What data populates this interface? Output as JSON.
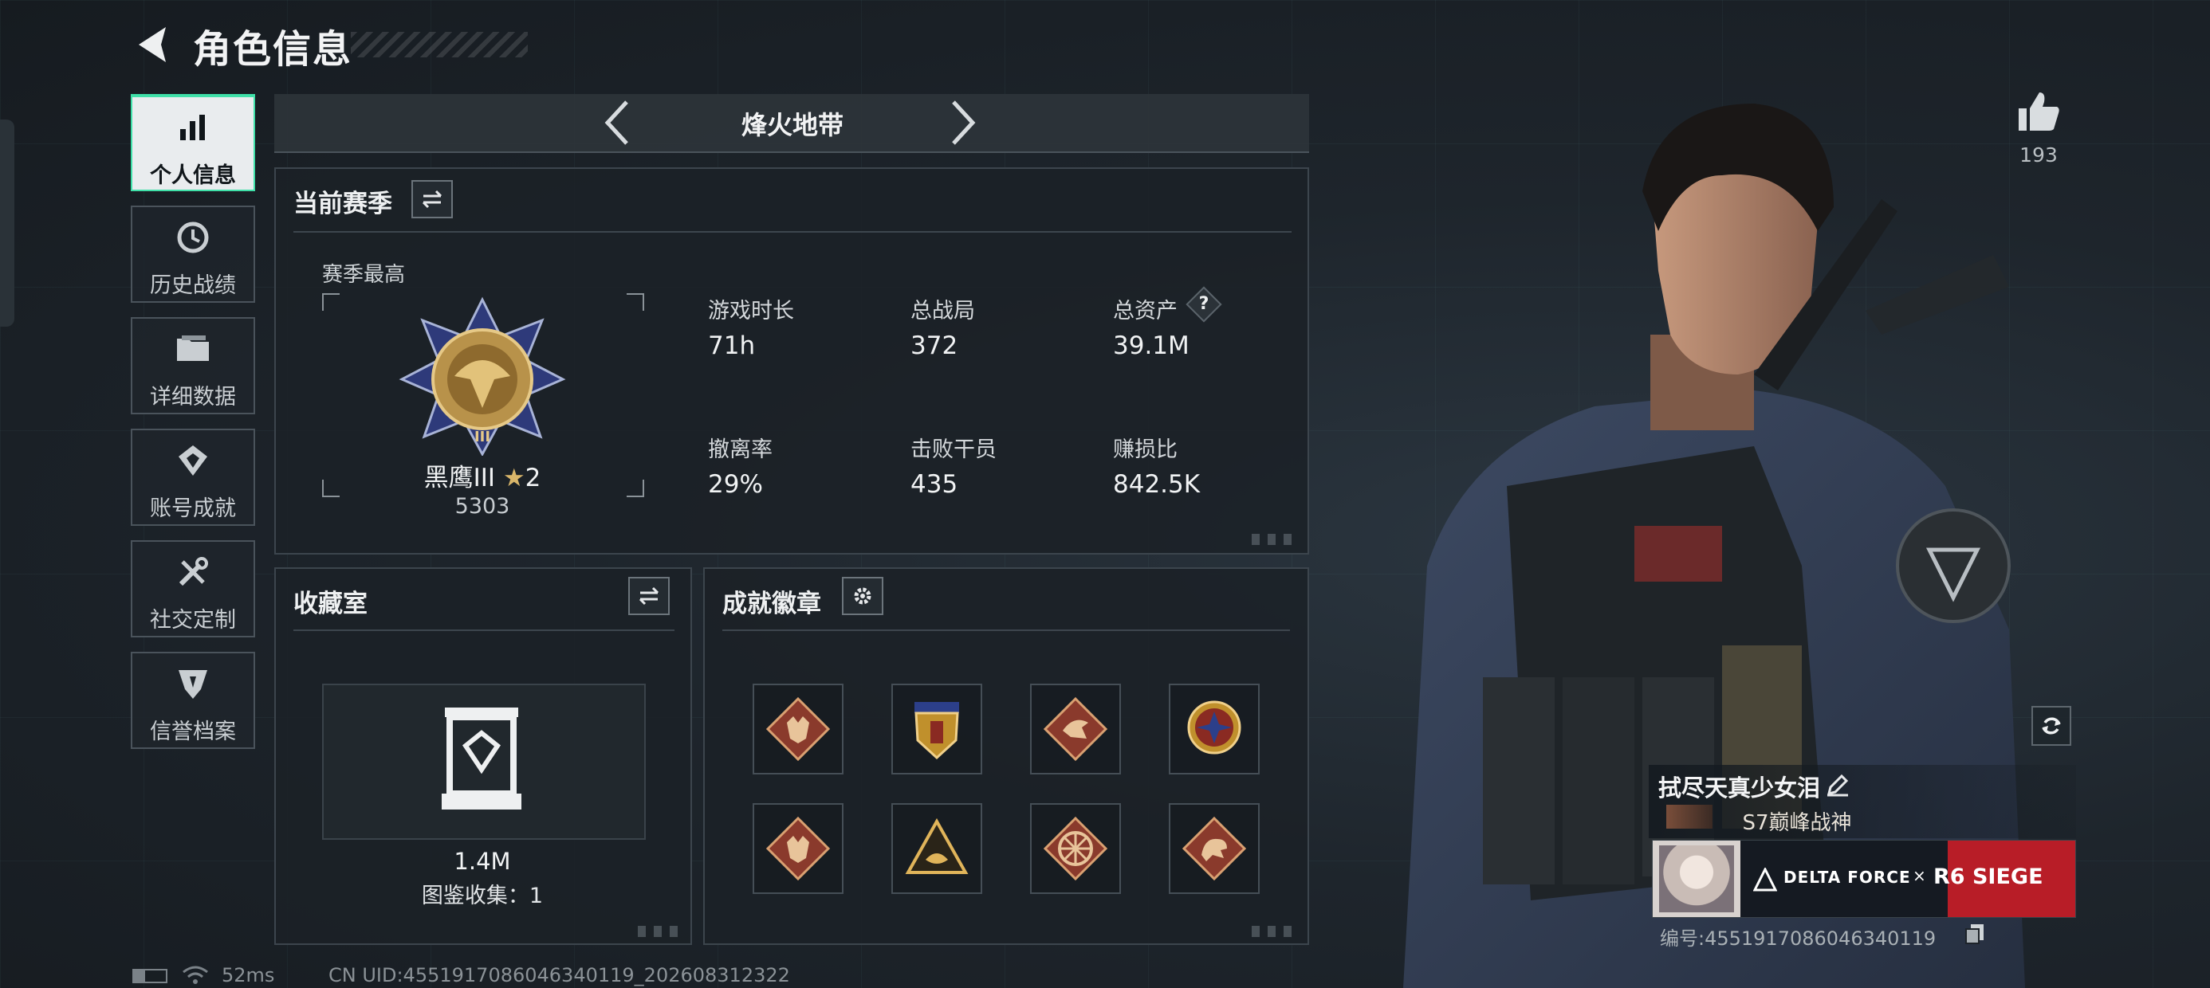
{
  "header": {
    "title": "角色信息"
  },
  "sidebar": {
    "items": [
      {
        "label": "个人信息",
        "icon": "bar-chart-icon",
        "active": true
      },
      {
        "label": "历史战绩",
        "icon": "history-clock-icon"
      },
      {
        "label": "详细数据",
        "icon": "folder-icon"
      },
      {
        "label": "账号成就",
        "icon": "achievement-icon"
      },
      {
        "label": "社交定制",
        "icon": "tools-icon"
      },
      {
        "label": "信誉档案",
        "icon": "shield-icon"
      }
    ]
  },
  "mode_selector": {
    "label": "烽火地带"
  },
  "season": {
    "title": "当前赛季",
    "best_label": "赛季最高",
    "rank_name": "黑鹰III",
    "rank_stars": "2",
    "rank_points": "5303",
    "stats": [
      {
        "label": "游戏时长",
        "value": "71h"
      },
      {
        "label": "总战局",
        "value": "372"
      },
      {
        "label": "总资产",
        "value": "39.1M"
      },
      {
        "label": "撤离率",
        "value": "29%"
      },
      {
        "label": "击败干员",
        "value": "435"
      },
      {
        "label": "赚损比",
        "value": "842.5K"
      }
    ]
  },
  "collection": {
    "title": "收藏室",
    "value": "1.4M",
    "caption": "图鉴收集：1"
  },
  "achievements": {
    "title": "成就徽章",
    "badges": [
      "wolf-badge-icon",
      "shield-crest-badge-icon",
      "raptor-badge-icon",
      "star-medal-badge-icon",
      "wolf-badge-icon",
      "triangle-eye-badge-icon",
      "wheel-badge-icon",
      "dragon-badge-icon"
    ]
  },
  "profile": {
    "likes": "193",
    "player_name": "拭尽天真少女泪",
    "player_title": "S7巅峰战神",
    "banner_text_left": "DELTA FORCE",
    "banner_x": "×",
    "banner_text_right": "R6 SIEGE",
    "id_text": "编号:4551917086046340119"
  },
  "status_bar": {
    "ping": "52ms",
    "uid": "CN UID:4551917086046340119_202608312322"
  },
  "colors": {
    "accent": "#3fe0a8",
    "background": "#1d2329",
    "panel_border": "#3c454d",
    "banner_red": "#c8202a"
  }
}
